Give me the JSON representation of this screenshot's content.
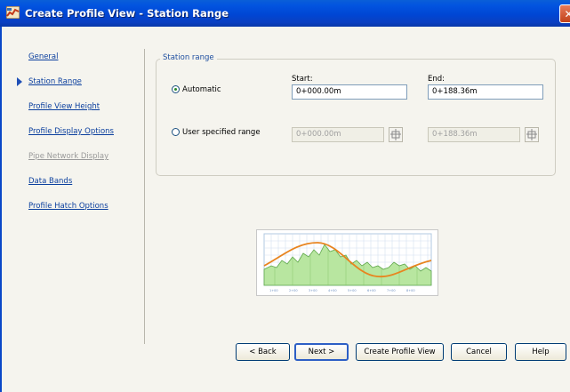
{
  "window": {
    "title": "Create Profile View - Station Range"
  },
  "nav": {
    "items": [
      {
        "label": "General",
        "state": "link"
      },
      {
        "label": "Station Range",
        "state": "current"
      },
      {
        "label": "Profile View Height",
        "state": "link"
      },
      {
        "label": "Profile Display Options",
        "state": "link"
      },
      {
        "label": "Pipe Network Display",
        "state": "disabled"
      },
      {
        "label": "Data Bands",
        "state": "link"
      },
      {
        "label": "Profile Hatch Options",
        "state": "link"
      }
    ]
  },
  "station_range": {
    "group_label": "Station range",
    "start_label": "Start:",
    "end_label": "End:",
    "automatic": {
      "label": "Automatic",
      "checked": true,
      "start": "0+000.00m",
      "end": "0+188.36m"
    },
    "user_range": {
      "label": "User specified range",
      "checked": false,
      "start": "0+000.00m",
      "end": "0+188.36m"
    }
  },
  "buttons": {
    "back": "< Back",
    "next": "Next >",
    "create": "Create Profile View",
    "cancel": "Cancel",
    "help": "Help"
  },
  "colors": {
    "title_bar": "#0a4fd8",
    "link": "#0b3f9e",
    "preview_curve": "#e8841f",
    "preview_fill": "#b8e6a0"
  },
  "icons": {
    "app": "profile-view-icon",
    "close": "close-icon",
    "pick": "pick-station-icon"
  }
}
